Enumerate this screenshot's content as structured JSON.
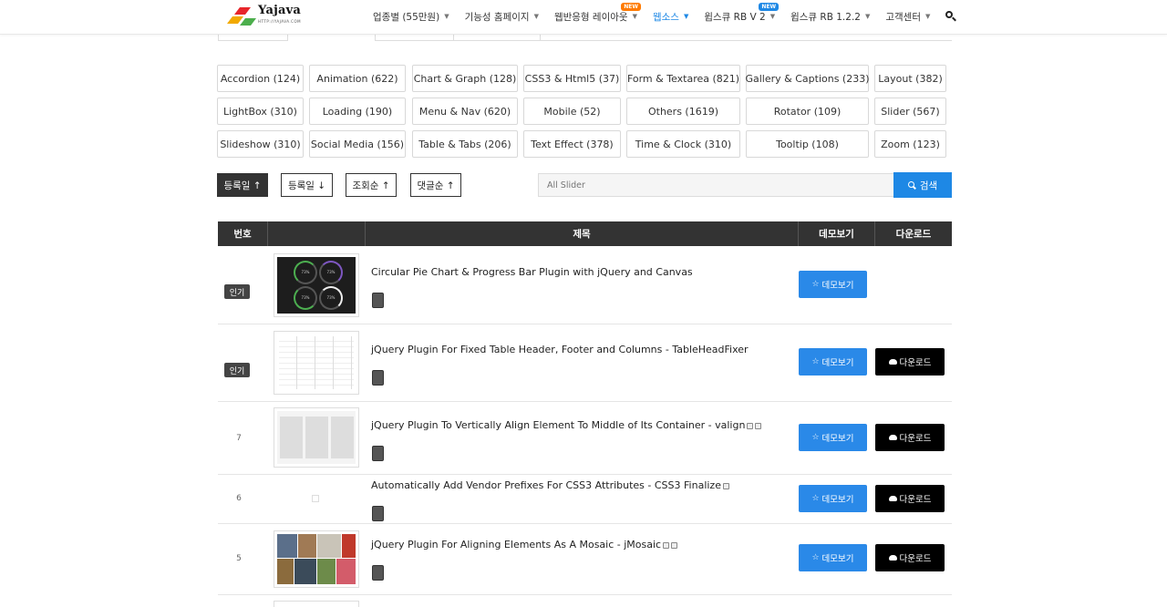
{
  "header": {
    "logo_text": "Yajava",
    "logo_sub": "HTTP://YAJAVA.COM",
    "nav": [
      {
        "label": "업종별 (55만원)",
        "active": false,
        "badge": ""
      },
      {
        "label": "기능성 홈페이지",
        "active": false,
        "badge": ""
      },
      {
        "label": "웹반응형 레이아웃",
        "active": false,
        "badge": "NEW"
      },
      {
        "label": "웹소스",
        "active": true,
        "badge": ""
      },
      {
        "label": "윕스큐 RB V 2",
        "active": false,
        "badge": "NEW"
      },
      {
        "label": "윕스큐 RB 1.2.2",
        "active": false,
        "badge": ""
      },
      {
        "label": "고객센터",
        "active": false,
        "badge": ""
      }
    ]
  },
  "categories": [
    "Accordion (124)",
    "Animation (622)",
    "Chart & Graph (128)",
    "CSS3 & Html5 (37)",
    "Form & Textarea (821)",
    "Gallery & Captions (233)",
    "Layout (382)",
    "LightBox (310)",
    "Loading (190)",
    "Menu & Nav (620)",
    "Mobile (52)",
    "Others (1619)",
    "Rotator (109)",
    "Slider (567)",
    "Slideshow (310)",
    "Social Media (156)",
    "Table & Tabs (206)",
    "Text Effect (378)",
    "Time & Clock (310)",
    "Tooltip (108)",
    "Zoom (123)"
  ],
  "sort": [
    {
      "label": "등록일 ↑",
      "active": true
    },
    {
      "label": "등록일 ↓",
      "active": false
    },
    {
      "label": "조회순 ↑",
      "active": false
    },
    {
      "label": "댓글순 ↑",
      "active": false
    }
  ],
  "search": {
    "placeholder": "All Slider",
    "button": "검색"
  },
  "table": {
    "headers": [
      "번호",
      "제목",
      "데모보기",
      "다운로드"
    ],
    "demo_label": "데모보기",
    "download_label": "다운로드",
    "rows": [
      {
        "num": "",
        "hot": "인기",
        "title": "Circular Pie Chart & Progress Bar Plugin with jQuery and Canvas",
        "download": false,
        "thumb": "pie",
        "icons": 0
      },
      {
        "num": "",
        "hot": "인기",
        "title": "jQuery Plugin For Fixed Table Header, Footer and Columns - TableHeadFixer",
        "download": true,
        "thumb": "table",
        "icons": 0
      },
      {
        "num": "7",
        "hot": "",
        "title": "jQuery Plugin To Vertically Align Element To Middle of Its Container - valign",
        "download": true,
        "thumb": "valign",
        "icons": 2
      },
      {
        "num": "6",
        "hot": "",
        "title": "Automatically Add Vendor Prefixes For CSS3 Attributes - CSS3 Finalize",
        "download": true,
        "thumb": "none",
        "icons": 1
      },
      {
        "num": "5",
        "hot": "",
        "title": "jQuery Plugin For Aligning Elements As A Mosaic - jMosaic",
        "download": true,
        "thumb": "mosaic",
        "icons": 2
      }
    ]
  },
  "colors": {
    "accent": "#1e88e5",
    "dark": "#333333",
    "hot_badge": "#ff7a00"
  }
}
